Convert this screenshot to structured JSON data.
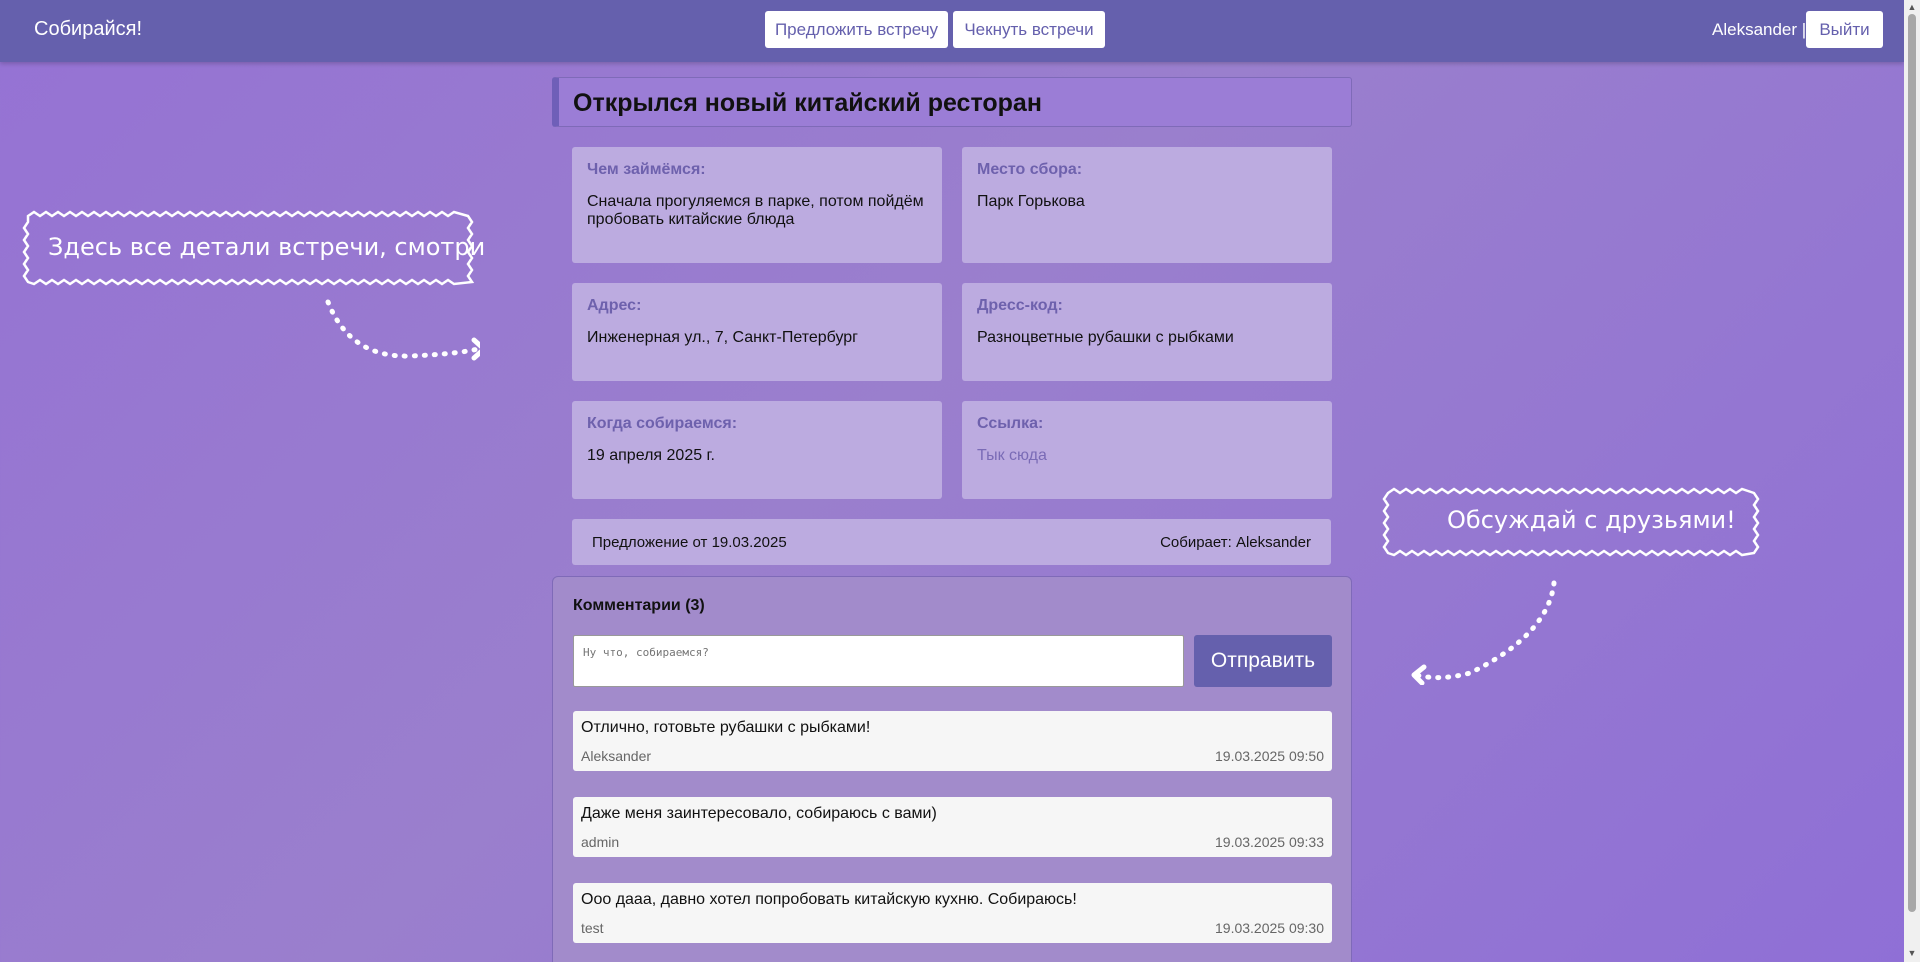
{
  "header": {
    "brand": "Собирайся!",
    "propose_button": "Предложить встречу",
    "check_button": "Чекнуть встречи",
    "user": "Aleksander |",
    "logout_button": "Выйти"
  },
  "meeting": {
    "title": "Открылся новый китайский ресторан",
    "fields": [
      {
        "label": "Чем займёмся:",
        "value": "Сначала прогуляемся в парке, потом пойдём пробовать китайские блюда"
      },
      {
        "label": "Место сбора:",
        "value": "Парк Горькова"
      },
      {
        "label": "Адрес:",
        "value": "Инженерная ул., 7, Санкт-Петербург"
      },
      {
        "label": "Дресс-код:",
        "value": "Разноцветные рубашки с рыбками"
      },
      {
        "label": "Когда собираемся:",
        "value": "19 апреля 2025 г."
      },
      {
        "label": "Ссылка:",
        "value": "Тык сюда"
      }
    ],
    "proposed": "Предложение от 19.03.2025",
    "organizer": "Собирает: Aleksander"
  },
  "comments": {
    "title": "Комментарии (3)",
    "placeholder": "Ну что, собираемся?",
    "send_button": "Отправить",
    "items": [
      {
        "text": "Отлично, готовьте рубашки с рыбками!",
        "author": "Aleksander",
        "date": "19.03.2025 09:50"
      },
      {
        "text": "Даже меня заинтересовало, собираюсь с вами)",
        "author": "admin",
        "date": "19.03.2025 09:33"
      },
      {
        "text": "Ооо дааа, давно хотел попробовать китайскую кухню. Собираюсь!",
        "author": "test",
        "date": "19.03.2025 09:30"
      }
    ]
  },
  "callouts": {
    "details": "Здесь все детали встречи, смотри",
    "discuss": "Обсуждай с друзьями!"
  },
  "colors": {
    "header": "#6560ad",
    "card": "#bcabe0",
    "label": "#6e61ad",
    "background": "#9572d4"
  }
}
